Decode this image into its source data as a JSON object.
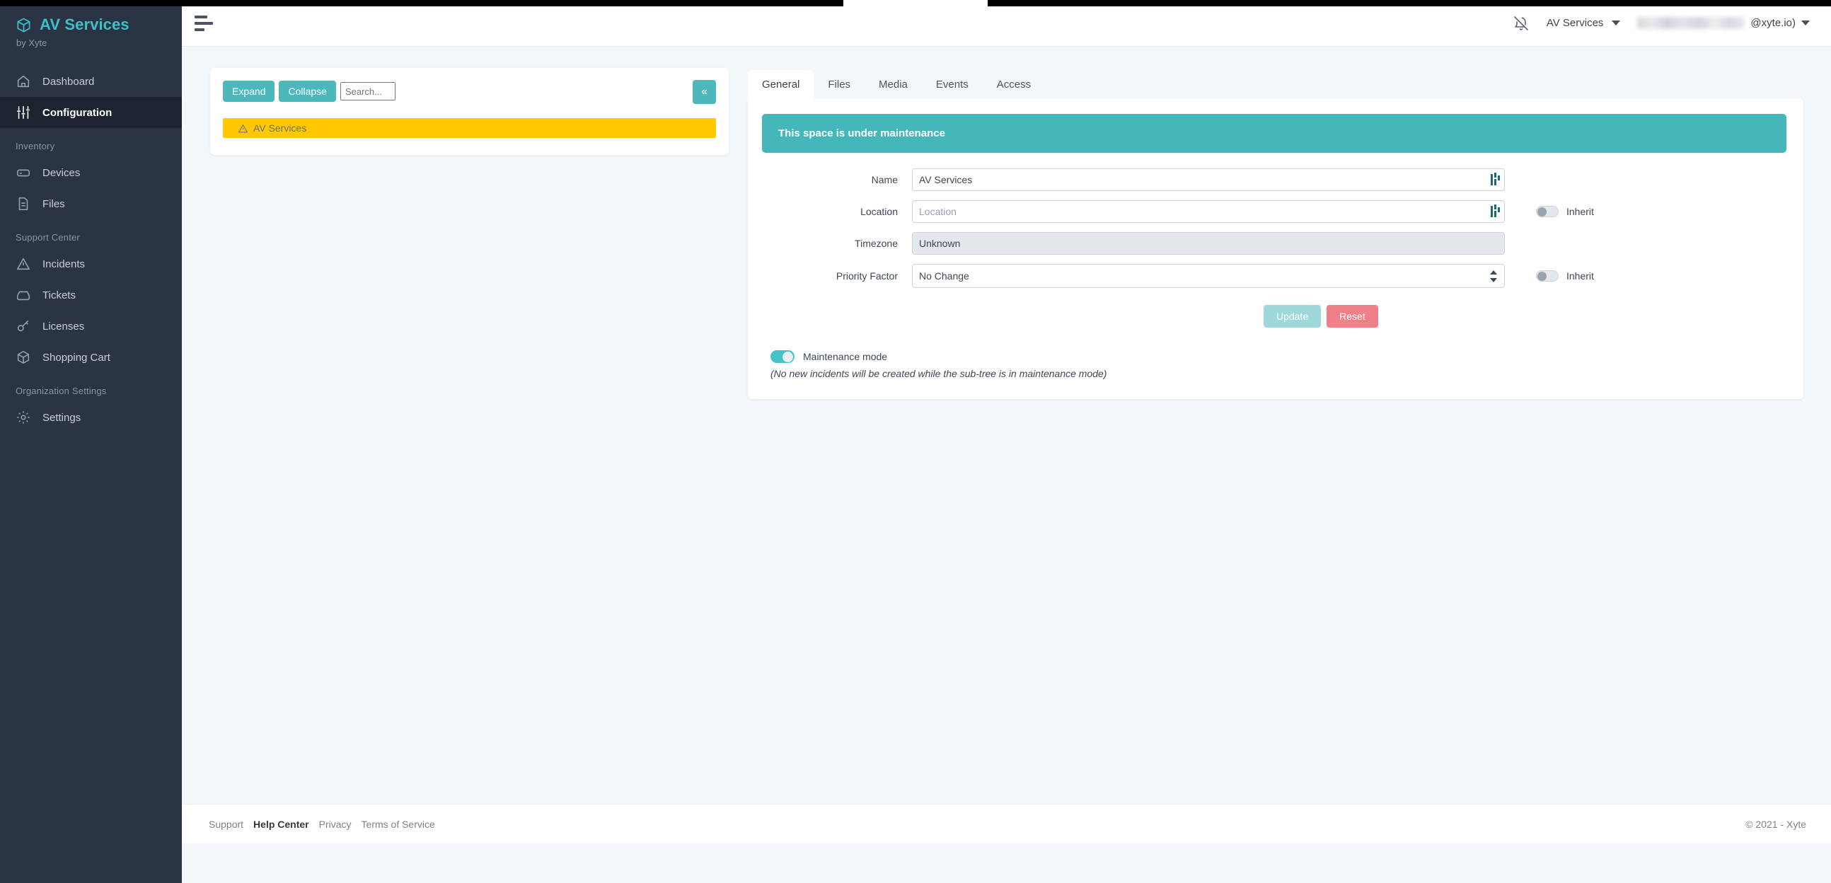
{
  "brand": {
    "name": "AV Services",
    "sub": "by Xyte",
    "logo_icon": "cube-icon",
    "accent": "#3dc0c9"
  },
  "sidebar": {
    "bg": "#2b3444",
    "items": [
      {
        "type": "link",
        "label": "Dashboard",
        "icon": "home-icon",
        "active": false
      },
      {
        "type": "link",
        "label": "Configuration",
        "icon": "sliders-icon",
        "active": true
      },
      {
        "type": "group",
        "label": "Inventory"
      },
      {
        "type": "link",
        "label": "Devices",
        "icon": "server-icon",
        "active": false
      },
      {
        "type": "link",
        "label": "Files",
        "icon": "file-icon",
        "active": false
      },
      {
        "type": "group",
        "label": "Support Center"
      },
      {
        "type": "link",
        "label": "Incidents",
        "icon": "warning-icon",
        "active": false
      },
      {
        "type": "link",
        "label": "Tickets",
        "icon": "inbox-icon",
        "active": false
      },
      {
        "type": "link",
        "label": "Licenses",
        "icon": "key-icon",
        "active": false
      },
      {
        "type": "link",
        "label": "Shopping Cart",
        "icon": "cube-icon",
        "active": false
      },
      {
        "type": "group",
        "label": "Organization Settings"
      },
      {
        "type": "link",
        "label": "Settings",
        "icon": "gear-icon",
        "active": false
      }
    ]
  },
  "topbar": {
    "menu_icon": "hamburger-icon",
    "notifications_icon": "bell-off-icon",
    "space_selector": {
      "label": "AV Services",
      "caret_icon": "chevron-down-icon"
    },
    "user_menu": {
      "email_suffix": "@xyte.io)",
      "caret_icon": "chevron-down-icon"
    }
  },
  "tree_panel": {
    "expand_label": "Expand",
    "collapse_label": "Collapse",
    "search_placeholder": "Search...",
    "search_value": "",
    "collapse_panel_icon": "«",
    "accent": "#4cb8bc",
    "rows": [
      {
        "label": "AV Services",
        "icon": "warning-triangle-icon",
        "highlight": "#ffc800"
      }
    ]
  },
  "detail_panel": {
    "tabs": [
      {
        "label": "General",
        "active": true
      },
      {
        "label": "Files",
        "active": false
      },
      {
        "label": "Media",
        "active": false
      },
      {
        "label": "Events",
        "active": false
      },
      {
        "label": "Access",
        "active": false
      }
    ],
    "banner": {
      "text": "This space is under maintenance",
      "color": "#45b6ba"
    },
    "fields": [
      {
        "label": "Name",
        "kind": "text",
        "value": "AV Services",
        "placeholder": "Name",
        "readonly": false,
        "ime_icon": "ime-indicator-icon",
        "inherit": null
      },
      {
        "label": "Location",
        "kind": "text",
        "value": "",
        "placeholder": "Location",
        "readonly": false,
        "ime_icon": "ime-indicator-icon",
        "inherit": {
          "label": "Inherit",
          "on": false
        }
      },
      {
        "label": "Timezone",
        "kind": "readonly",
        "value": "Unknown",
        "placeholder": "",
        "readonly": true,
        "ime_icon": null,
        "inherit": null
      },
      {
        "label": "Priority Factor",
        "kind": "select",
        "value": "No Change",
        "placeholder": "",
        "readonly": false,
        "ime_icon": null,
        "inherit": {
          "label": "Inherit",
          "on": false
        }
      }
    ],
    "priority_options": [
      "No Change"
    ],
    "actions": {
      "update_label": "Update",
      "update_disabled": true,
      "update_color": "#9ed8da",
      "reset_label": "Reset",
      "reset_color": "#ef7f89"
    },
    "maintenance": {
      "toggle_on": true,
      "label": "Maintenance mode",
      "note": "(No new incidents will be created while the sub-tree is in maintenance mode)",
      "on_color": "#45c3c7"
    }
  },
  "footer": {
    "links": [
      {
        "label": "Support",
        "strong": false
      },
      {
        "label": "Help Center",
        "strong": true
      },
      {
        "label": "Privacy",
        "strong": false
      },
      {
        "label": "Terms of Service",
        "strong": false
      }
    ],
    "copyright": "© 2021 - Xyte"
  }
}
